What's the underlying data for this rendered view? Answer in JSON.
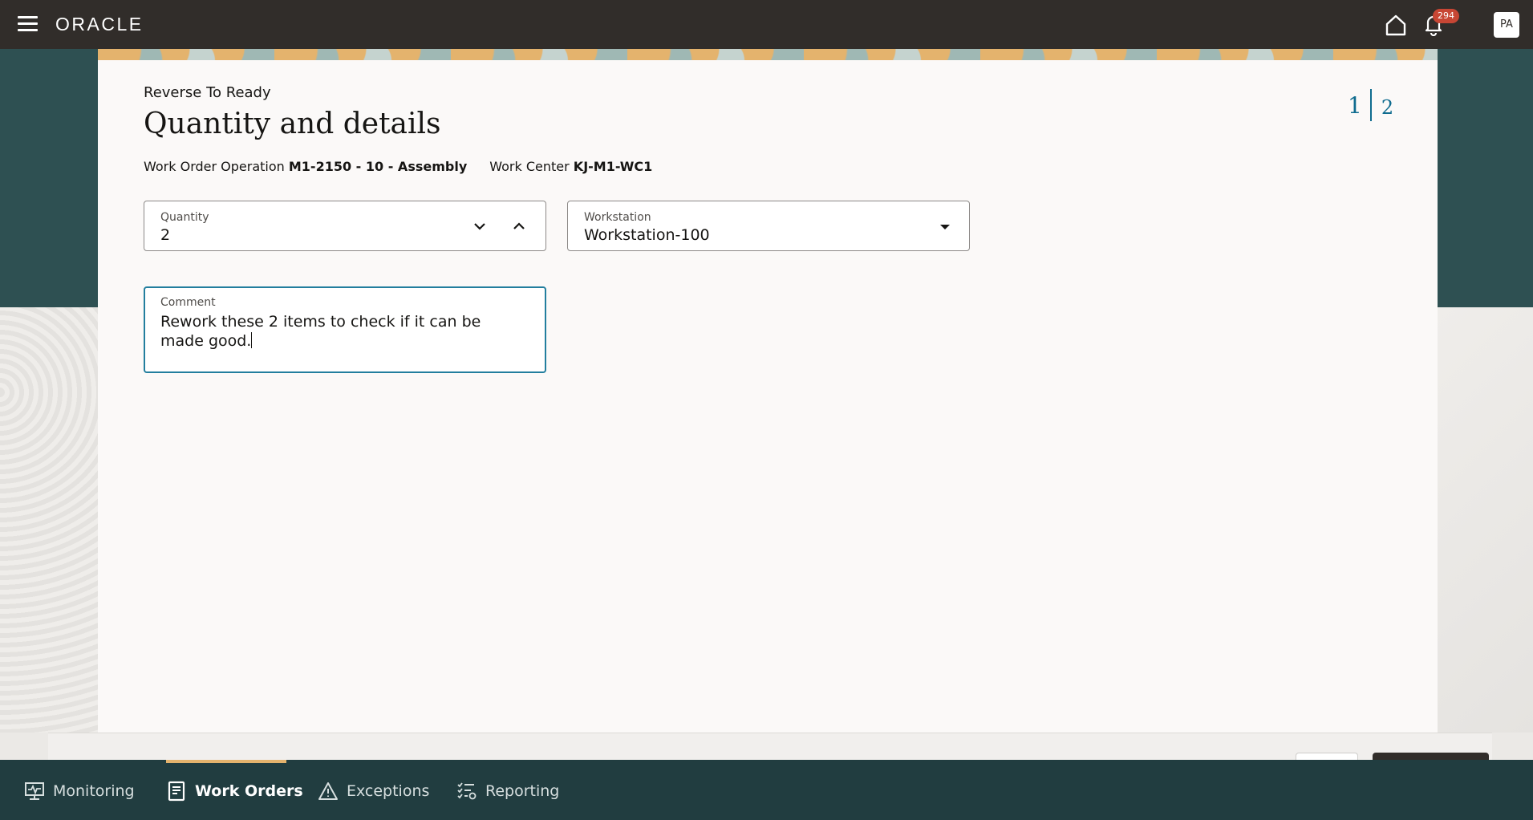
{
  "header": {
    "brand": "ORACLE",
    "notification_count": "294",
    "user_initials": "PA"
  },
  "page": {
    "subtitle": "Reverse To Ready",
    "title": "Quantity and details",
    "steps": {
      "current": "1",
      "total": "2"
    },
    "work_order_operation": {
      "label": "Work Order Operation",
      "value": "M1-2150 - 10 - Assembly"
    },
    "work_center": {
      "label": "Work Center",
      "value": "KJ-M1-WC1"
    }
  },
  "form": {
    "quantity": {
      "label": "Quantity",
      "value": "2"
    },
    "workstation": {
      "label": "Workstation",
      "value": "Workstation-100"
    },
    "comment": {
      "label": "Comment",
      "value": "Rework these 2 items to check if it can be made good."
    }
  },
  "bottom_nav": {
    "items": [
      {
        "label": "Monitoring",
        "icon": "monitoring-icon"
      },
      {
        "label": "Work Orders",
        "icon": "work-orders-icon",
        "active": true
      },
      {
        "label": "Exceptions",
        "icon": "warning-triangle-icon"
      },
      {
        "label": "Reporting",
        "icon": "reporting-checklist-icon"
      }
    ]
  },
  "colors": {
    "header_bg": "#312d2a",
    "banner_bg": "#2e5052",
    "nav_bg": "#213d40",
    "accent": "#0f6c8f",
    "active_underline": "#e4b36d",
    "badge": "#c74634"
  }
}
